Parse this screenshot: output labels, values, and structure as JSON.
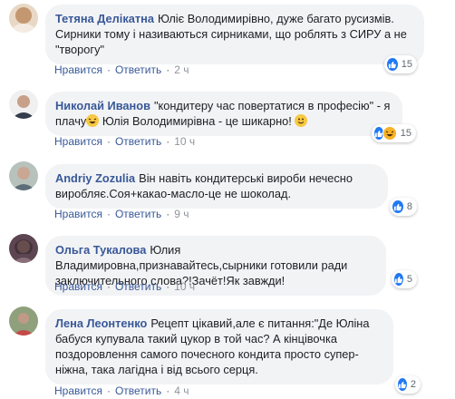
{
  "comments": [
    {
      "author": "Тетяна Делікатна",
      "text": "Юліє Володимирівно, дуже багато русизмів. Сирники тому і називаються сирниками, що роблять з СИРУ а не \"творогу\"",
      "like_label": "Нравится",
      "reply_label": "Ответить",
      "time": "2 ч",
      "reactions": [
        "like"
      ],
      "reaction_count": "15",
      "avatar_color": "#c9a98a"
    },
    {
      "author": "Николай Иванов",
      "text": "\"кондитеру час повертатися в професію\" - я плачу",
      "text2": " Юлія Володимирівна - це шикарно!",
      "like_label": "Нравится",
      "reply_label": "Ответить",
      "time": "10 ч",
      "reactions": [
        "like",
        "haha"
      ],
      "reaction_count": "15",
      "avatar_color": "#d8d8d8"
    },
    {
      "author": "Andriy Zozulia",
      "text": "Він навіть кондитерські вироби нечесно виробляє.Соя+какао-масло-це не шоколад.",
      "like_label": "Нравится",
      "reply_label": "Ответить",
      "time": "9 ч",
      "reactions": [
        "like"
      ],
      "reaction_count": "8",
      "avatar_color": "#9aa5a0"
    },
    {
      "author": "Ольга Тукалова",
      "text": "Юлия Владимировна,признавайтесь,сырники готовили ради заключительного слова?!Зачёт!Як завжди!",
      "like_label": "Нравится",
      "reply_label": "Ответить",
      "time": "10 ч",
      "reactions": [
        "like"
      ],
      "reaction_count": "5",
      "avatar_color": "#6b4a5a"
    },
    {
      "author": "Лена Леонтенко",
      "text": "Рецепт цікавий,але є питання:\"Де Юліна бабуся купувала такий цукор в той час? А кінцівочка поздоровлення самого почесного кондита просто супер-ніжна, така лагідна і від всього серця.",
      "like_label": "Нравится",
      "reply_label": "Ответить",
      "time": "4 ч",
      "reactions": [
        "like"
      ],
      "reaction_count": "2",
      "avatar_color": "#7a8a6a"
    }
  ]
}
